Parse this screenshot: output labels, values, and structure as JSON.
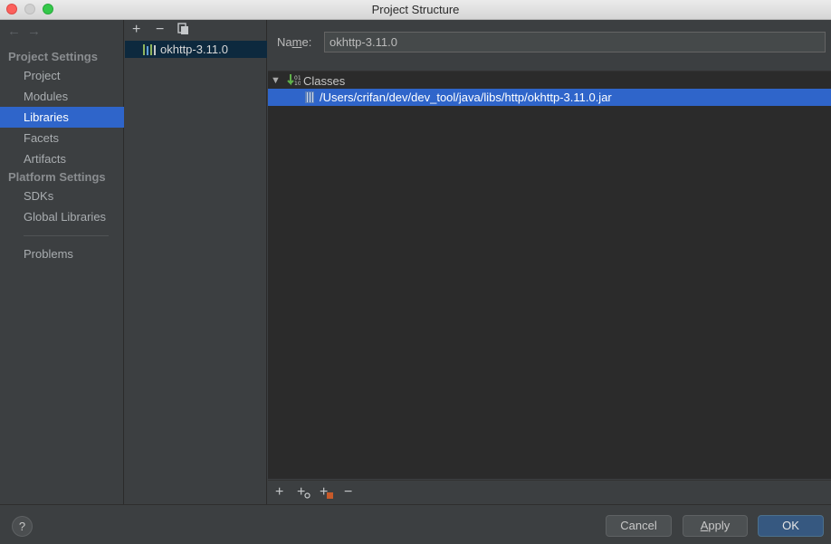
{
  "window": {
    "title": "Project Structure"
  },
  "nav": {
    "back_arrow": "←",
    "forward_arrow": "→",
    "project_settings_header": "Project Settings",
    "project_items": [
      "Project",
      "Modules",
      "Libraries",
      "Facets",
      "Artifacts"
    ],
    "platform_settings_header": "Platform Settings",
    "platform_items": [
      "SDKs",
      "Global Libraries"
    ],
    "problems": "Problems",
    "selected": "Libraries"
  },
  "library_list": {
    "tools": {
      "add": "+",
      "remove": "−",
      "copy_icon": "copy-icon"
    },
    "items": [
      "okhttp-3.11.0"
    ]
  },
  "details": {
    "name_label_pre": "Na",
    "name_label_mnemonic": "m",
    "name_label_post": "e:",
    "name_value": "okhttp-3.11.0",
    "tree": {
      "root_label": "Classes",
      "children": [
        "/Users/crifan/dev/dev_tool/java/libs/http/okhttp-3.11.0.jar"
      ]
    },
    "bottom_tools": {
      "add": "+",
      "add_with_settings": "+",
      "add_attach": "+",
      "remove": "−"
    }
  },
  "footer": {
    "help": "?",
    "cancel": "Cancel",
    "apply_mnemonic": "A",
    "apply_rest": "pply",
    "ok": "OK"
  },
  "colors": {
    "selection": "#2f65ca",
    "background": "#3c3f41",
    "tree_background": "#2b2b2b",
    "ok_button": "#365880"
  }
}
